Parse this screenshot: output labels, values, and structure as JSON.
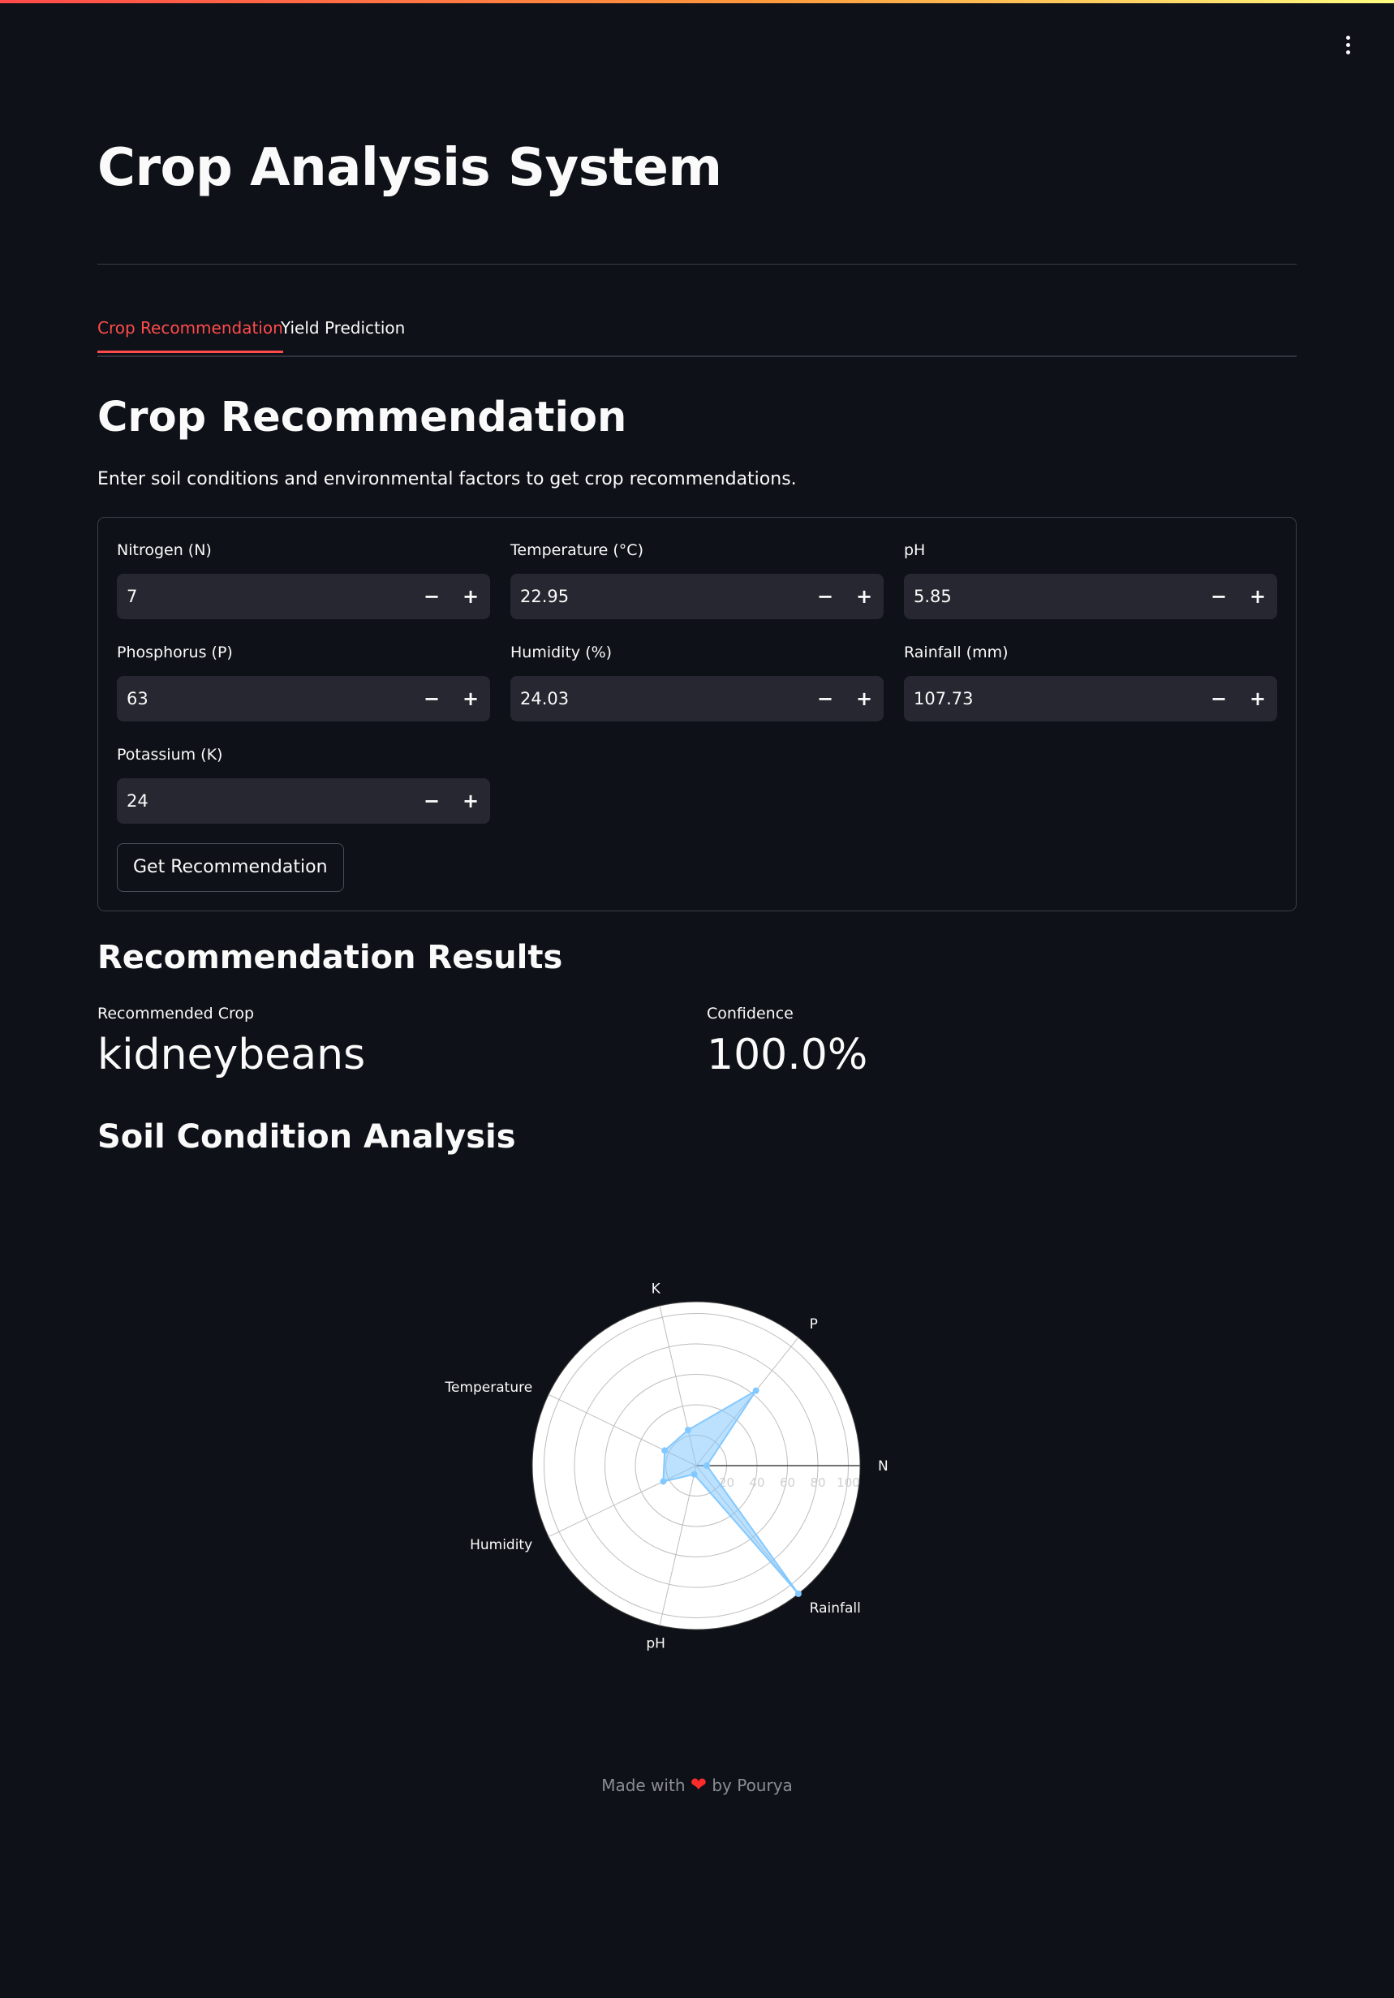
{
  "app": {
    "title": "Crop Analysis System"
  },
  "tabs": [
    {
      "label": "Crop Recommendation"
    },
    {
      "label": "Yield Prediction"
    }
  ],
  "section": {
    "heading": "Crop Recommendation",
    "description": "Enter soil conditions and environmental factors to get crop recommendations."
  },
  "form": {
    "fields": [
      {
        "label": "Nitrogen (N)",
        "value": "7"
      },
      {
        "label": "Temperature (°C)",
        "value": "22.95"
      },
      {
        "label": "pH",
        "value": "5.85"
      },
      {
        "label": "Phosphorus (P)",
        "value": "63"
      },
      {
        "label": "Humidity (%)",
        "value": "24.03"
      },
      {
        "label": "Rainfall (mm)",
        "value": "107.73"
      },
      {
        "label": "Potassium (K)",
        "value": "24"
      }
    ],
    "minus_symbol": "−",
    "plus_symbol": "+",
    "submit_label": "Get Recommendation"
  },
  "results": {
    "heading": "Recommendation Results",
    "crop_label": "Recommended Crop",
    "crop_value": "kidneybeans",
    "confidence_label": "Confidence",
    "confidence_value": "100.0%"
  },
  "analysis": {
    "heading": "Soil Condition Analysis"
  },
  "chart_data": {
    "type": "radar",
    "axes": [
      "N",
      "P",
      "K",
      "Temperature",
      "Humidity",
      "pH",
      "Rainfall"
    ],
    "values": [
      7,
      63,
      24,
      22.95,
      24.03,
      5.85,
      107.73
    ],
    "radial_ticks": [
      "20",
      "40",
      "60",
      "80",
      "100"
    ],
    "radial_range": [
      0,
      107.73
    ],
    "fill_color": "#83c9ff",
    "background_color": "#ffffff",
    "grid": true
  },
  "footer": {
    "prefix": "Made with",
    "heart": "❤",
    "suffix": "by Pourya"
  }
}
